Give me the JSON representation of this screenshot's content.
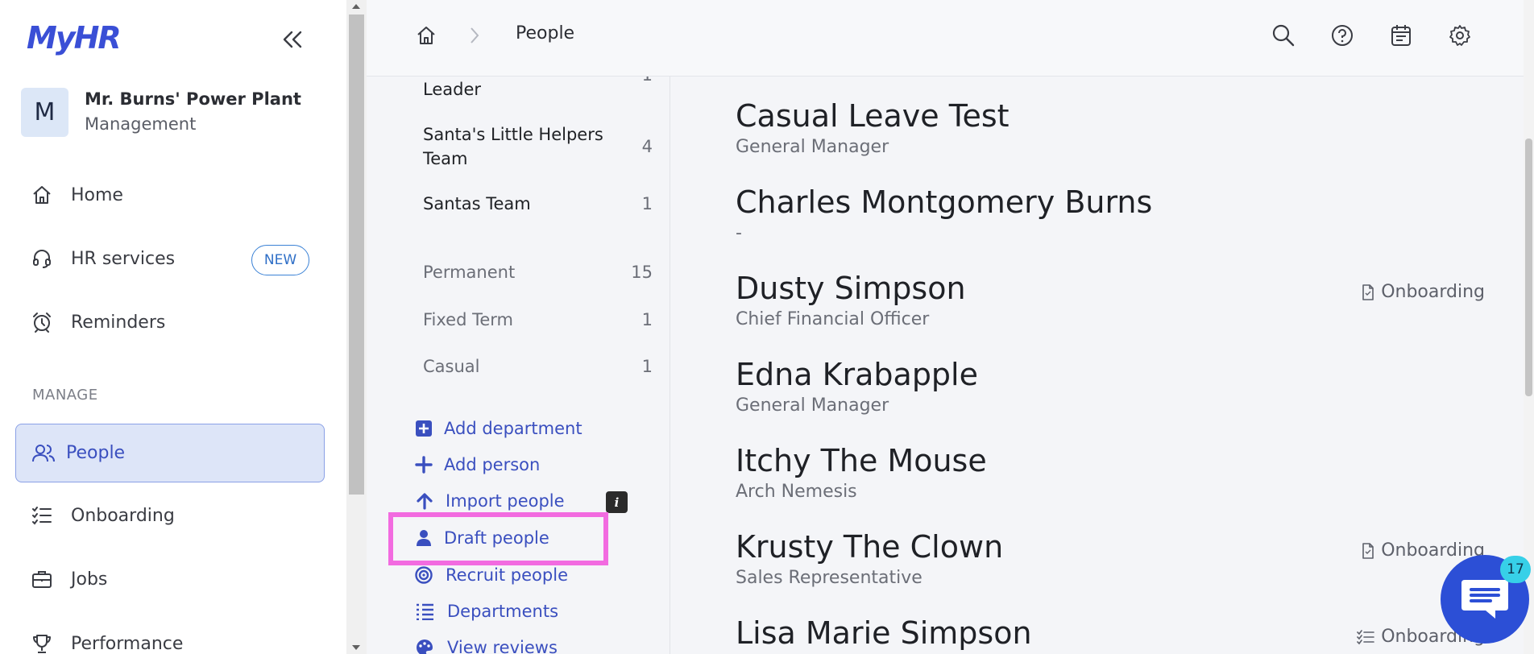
{
  "brand": {
    "logo_text": "MyHR",
    "accent": "#3a4fbf"
  },
  "org": {
    "initial": "M",
    "name": "Mr. Burns' Power Plant",
    "role": "Management"
  },
  "sidebar": {
    "items": [
      {
        "label": "Home",
        "icon": "home-icon"
      },
      {
        "label": "HR services",
        "icon": "headset-icon",
        "badge": "NEW"
      },
      {
        "label": "Reminders",
        "icon": "alarm-clock-icon"
      }
    ],
    "section_label": "MANAGE",
    "manage_items": [
      {
        "label": "People",
        "icon": "people-icon",
        "active": true
      },
      {
        "label": "Onboarding",
        "icon": "checklist-icon"
      },
      {
        "label": "Jobs",
        "icon": "briefcase-icon"
      },
      {
        "label": "Performance",
        "icon": "trophy-icon"
      }
    ]
  },
  "topbar": {
    "breadcrumb": "People"
  },
  "filters": {
    "teams": [
      {
        "label": "Leader",
        "count": "1"
      },
      {
        "label": "Santa's Little Helpers Team",
        "count": "4"
      },
      {
        "label": "Santas Team",
        "count": "1"
      }
    ],
    "types": [
      {
        "label": "Permanent",
        "count": "15"
      },
      {
        "label": "Fixed Term",
        "count": "1"
      },
      {
        "label": "Casual",
        "count": "1"
      }
    ],
    "actions": [
      {
        "label": "Add department",
        "icon": "plus-square-icon"
      },
      {
        "label": "Add person",
        "icon": "plus-icon"
      },
      {
        "label": "Import people",
        "icon": "arrow-up-icon",
        "info": "i"
      },
      {
        "label": "Draft people",
        "icon": "person-icon"
      },
      {
        "label": "Recruit people",
        "icon": "target-icon"
      },
      {
        "label": "Departments",
        "icon": "list-icon"
      },
      {
        "label": "View reviews",
        "icon": "palette-icon"
      }
    ]
  },
  "people": [
    {
      "name": "Casual Leave Test",
      "title": "General Manager",
      "status": ""
    },
    {
      "name": "Charles Montgomery Burns",
      "title": "-",
      "status": ""
    },
    {
      "name": "Dusty Simpson",
      "title": "Chief Financial Officer",
      "status": "Onboarding"
    },
    {
      "name": "Edna Krabapple",
      "title": "General Manager",
      "status": ""
    },
    {
      "name": "Itchy The Mouse",
      "title": "Arch Nemesis",
      "status": ""
    },
    {
      "name": "Krusty The Clown",
      "title": "Sales Representative",
      "status": "Onboarding"
    },
    {
      "name": "Lisa Marie Simpson",
      "title": "",
      "status": "Onboarding"
    }
  ],
  "chat": {
    "unread": "17"
  }
}
